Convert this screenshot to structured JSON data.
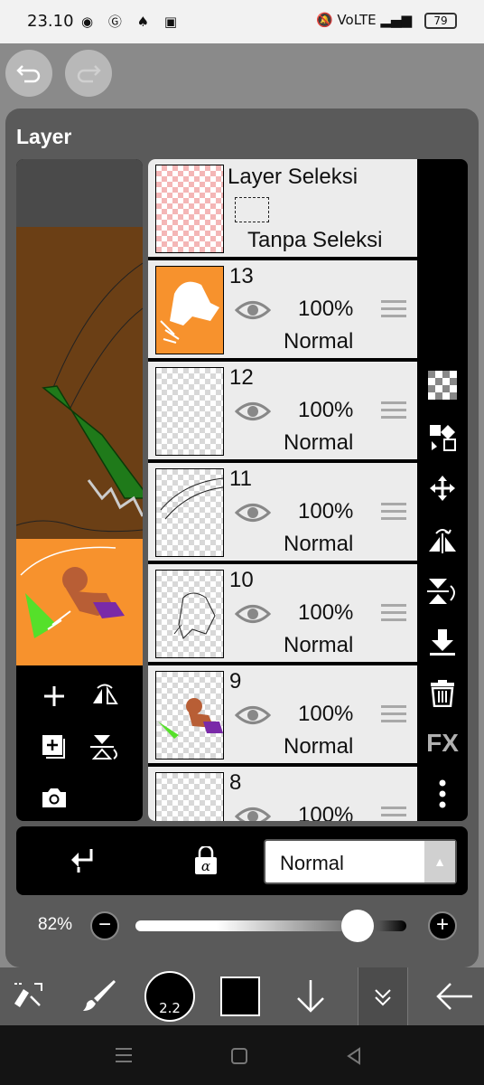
{
  "status_bar": {
    "time": "23.10",
    "app_icons": "◉ Ⓖ ♠ ▣",
    "system_icons": "🔕 VoLTE ▂▄▆",
    "battery": "79"
  },
  "panel": {
    "title": "Layer"
  },
  "selection_layer": {
    "title": "Layer Seleksi",
    "status": "Tanpa Seleksi"
  },
  "layers": [
    {
      "number": "13",
      "opacity": "100%",
      "blend": "Normal"
    },
    {
      "number": "12",
      "opacity": "100%",
      "blend": "Normal"
    },
    {
      "number": "11",
      "opacity": "100%",
      "blend": "Normal"
    },
    {
      "number": "10",
      "opacity": "100%",
      "blend": "Normal"
    },
    {
      "number": "9",
      "opacity": "100%",
      "blend": "Normal"
    },
    {
      "number": "8",
      "opacity": "100%",
      "blend": ""
    }
  ],
  "right_tools": [
    "checkerboard-icon",
    "layer-swap-icon",
    "move-icon",
    "flip-horizontal-icon",
    "flip-vertical-icon",
    "merge-down-icon",
    "trash-icon",
    "fx-icon",
    "more-icon"
  ],
  "right_tools_fx_label": "FX",
  "blend_mode": {
    "selected": "Normal"
  },
  "opacity": {
    "value_label": "82%",
    "value": 0.82
  },
  "brush": {
    "size": "2.2"
  },
  "colors": {
    "panel_bg": "#5a5a5a",
    "primary_color": "#000000",
    "thumb_orange": "#f7922d"
  }
}
